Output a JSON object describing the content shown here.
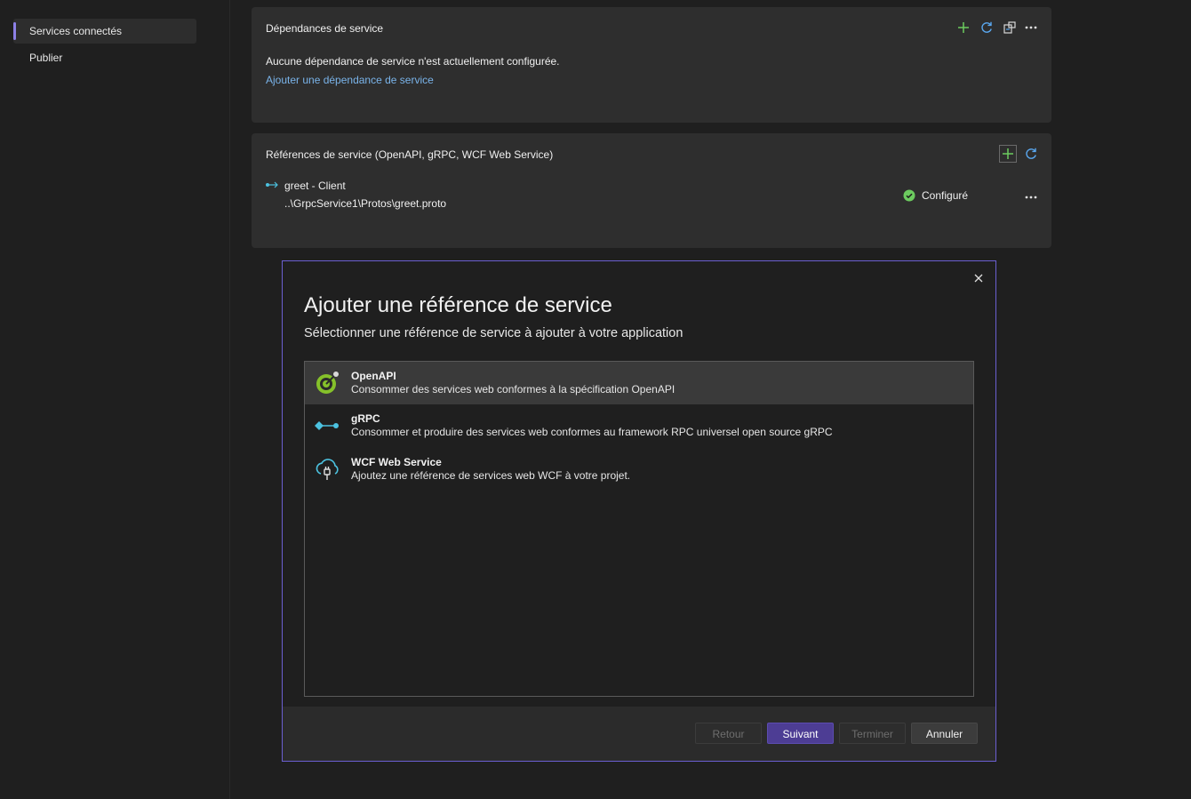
{
  "sidebar": {
    "items": [
      {
        "label": "Services connectés",
        "active": true
      },
      {
        "label": "Publier",
        "active": false
      }
    ]
  },
  "dependencies_card": {
    "title": "Dépendances de service",
    "empty_text": "Aucune dépendance de service n'est actuellement configurée.",
    "add_link": "Ajouter une dépendance de service",
    "icons": [
      "add-icon",
      "refresh-icon",
      "manage-icon",
      "more-icon"
    ]
  },
  "references_card": {
    "title": "Références de service (OpenAPI, gRPC, WCF Web Service)",
    "item": {
      "name": "greet - Client",
      "path": "..\\GrpcService1\\Protos\\greet.proto",
      "status": "Configuré",
      "status_color": "#6ccb5f"
    },
    "icons": [
      "add-icon",
      "refresh-icon",
      "more-icon"
    ]
  },
  "dialog": {
    "title": "Ajouter une référence de service",
    "subtitle": "Sélectionner une référence de service à ajouter à votre application",
    "options": [
      {
        "name": "OpenAPI",
        "description": "Consommer des services web conformes à la spécification OpenAPI",
        "icon": "openapi-icon",
        "selected": true
      },
      {
        "name": "gRPC",
        "description": "Consommer et produire des services web conformes au framework RPC universel open source gRPC",
        "icon": "grpc-icon",
        "selected": false
      },
      {
        "name": "WCF Web Service",
        "description": "Ajoutez une référence de services web WCF à votre projet.",
        "icon": "wcf-icon",
        "selected": false
      }
    ],
    "buttons": {
      "back": "Retour",
      "next": "Suivant",
      "finish": "Terminer",
      "cancel": "Annuler"
    }
  },
  "colors": {
    "accent": "#8c80e6",
    "link": "#7ab4ea",
    "primary_button": "#4d3d94",
    "add_icon": "#6ccb5f",
    "refresh_icon": "#5aa8f0"
  }
}
